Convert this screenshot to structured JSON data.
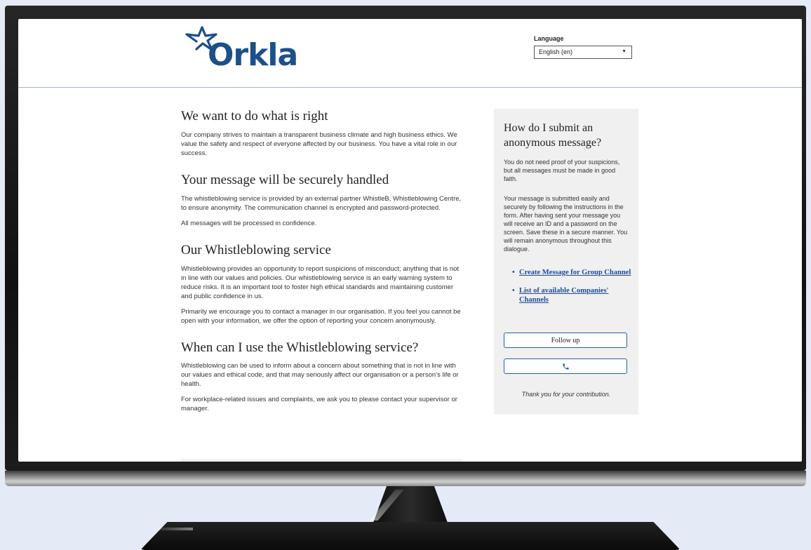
{
  "header": {
    "brand": "Orkla",
    "language_label": "Language",
    "language_selected": "English (en)"
  },
  "main": {
    "sections": [
      {
        "title": "We want to do what is right",
        "paragraphs": [
          "Our company strives to maintain a transparent business climate and high business ethics. We value the safety and respect of everyone affected by our business. You have a vital role in our success."
        ]
      },
      {
        "title": "Your message will be securely handled",
        "paragraphs": [
          "The whistleblowing service is provided by an external partner WhistleB, Whistleblowing Centre, to ensure anonymity. The communication channel is encrypted and password-protected.",
          "All messages will be processed in confidence."
        ]
      },
      {
        "title": "Our Whistleblowing service",
        "paragraphs": [
          "Whistleblowing provides an opportunity to report suspicions of misconduct; anything that is not in line with our values and policies.  Our whistleblowing service is an early warning system to reduce risks. It is an important tool to foster high ethical standards and maintaining customer and public confidence in us.",
          "Primarily we encourage you to contact a manager in our organisation. If you feel you cannot be open with your information, we offer the option of reporting your concern anonymously."
        ]
      },
      {
        "title": "When can I use the Whistleblowing service?",
        "paragraphs": [
          "Whistleblowing can be used to inform about a concern about something that is not in line with our values and ethical code, and that may seriously affect our organisation or a person’s life or health.",
          "For workplace-related issues and complaints, we ask you to please contact your supervisor or manager."
        ]
      }
    ]
  },
  "sidebar": {
    "title": "How do I submit an anonymous message?",
    "p1": "You do not need proof of your suspicions, but all messages must be made in good faith.",
    "p2": "Your message is submitted easily and securely by following the instructions in the form. After having sent your message you will receive an ID and a password on the screen. Save these in a secure manner. You will remain anonymous throughout this dialogue.",
    "links": [
      "Create Message for Group Channel",
      "List of available Companies' Channels"
    ],
    "follow_up_label": "Follow up",
    "phone_icon": "phone-icon",
    "thanks": "Thank you for your contribution."
  },
  "colors": {
    "brand_blue": "#1d4f8a",
    "link_blue": "#1f4b96",
    "button_border": "#2a5ea8",
    "sidebar_bg": "#f0f0f0"
  }
}
